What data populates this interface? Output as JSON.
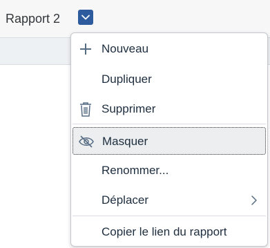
{
  "tab": {
    "title": "Rapport 2"
  },
  "menu": {
    "items": [
      {
        "label": "Nouveau",
        "icon": "plus-icon"
      },
      {
        "label": "Dupliquer",
        "icon": ""
      },
      {
        "label": "Supprimer",
        "icon": "trash-icon"
      },
      {
        "label": "Masquer",
        "icon": "eye-slash-icon",
        "selected": true
      },
      {
        "label": "Renommer...",
        "icon": ""
      },
      {
        "label": "Déplacer",
        "icon": "",
        "submenu": true
      },
      {
        "label": "Copier le lien du rapport",
        "icon": ""
      }
    ]
  },
  "colors": {
    "accent": "#2d5b9e",
    "text": "#1d2d3e",
    "icon": "#556b82"
  }
}
